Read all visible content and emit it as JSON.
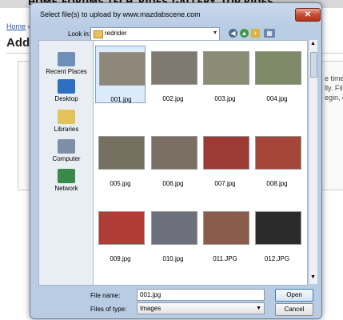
{
  "site": {
    "nav": [
      "HOME",
      "FORUMS",
      "TECH",
      "RIDES",
      "GALLERY",
      "TOP RIDES"
    ],
    "breadcrumb_home": "Home",
    "breadcrumb_sep": "»",
    "breadcrumb_partial": "p",
    "title": "Add P",
    "side_lines": [
      "e time.",
      "lly. File",
      "egin, c"
    ]
  },
  "dialog": {
    "title": "Select file(s) to upload by www.mazdabscene.com",
    "close_label": "✕",
    "look_in_label": "Look in:",
    "look_in_value": "redrider",
    "places": [
      {
        "label": "Recent Places",
        "icon": "recent-places-icon",
        "color": "#6d8fb8"
      },
      {
        "label": "Desktop",
        "icon": "desktop-icon",
        "color": "#2f6fc0"
      },
      {
        "label": "Libraries",
        "icon": "libraries-icon",
        "color": "#e2c35a"
      },
      {
        "label": "Computer",
        "icon": "computer-icon",
        "color": "#7c8fa6"
      },
      {
        "label": "Network",
        "icon": "network-icon",
        "color": "#3a8a4a"
      }
    ],
    "files": [
      {
        "name": "001.jpg",
        "color": "#8f877a",
        "selected": true
      },
      {
        "name": "002.jpg",
        "color": "#7e7a72",
        "selected": false
      },
      {
        "name": "003.jpg",
        "color": "#8a8c73",
        "selected": false
      },
      {
        "name": "004.jpg",
        "color": "#7f8a68",
        "selected": false
      },
      {
        "name": "005.jpg",
        "color": "#75705f",
        "selected": false
      },
      {
        "name": "006.jpg",
        "color": "#7a6f62",
        "selected": false
      },
      {
        "name": "007.jpg",
        "color": "#9c3b34",
        "selected": false
      },
      {
        "name": "008.jpg",
        "color": "#a4463a",
        "selected": false
      },
      {
        "name": "009.jpg",
        "color": "#b03c36",
        "selected": false
      },
      {
        "name": "010.jpg",
        "color": "#6d6f7a",
        "selected": false
      },
      {
        "name": "011.JPG",
        "color": "#8c5c4a",
        "selected": false
      },
      {
        "name": "012.JPG",
        "color": "#2b2b2b",
        "selected": false
      }
    ],
    "file_name_label": "File name:",
    "file_name_value": "001.jpg",
    "files_of_type_label": "Files of type:",
    "files_of_type_value": "Images",
    "open_label": "Open",
    "cancel_label": "Cancel"
  }
}
